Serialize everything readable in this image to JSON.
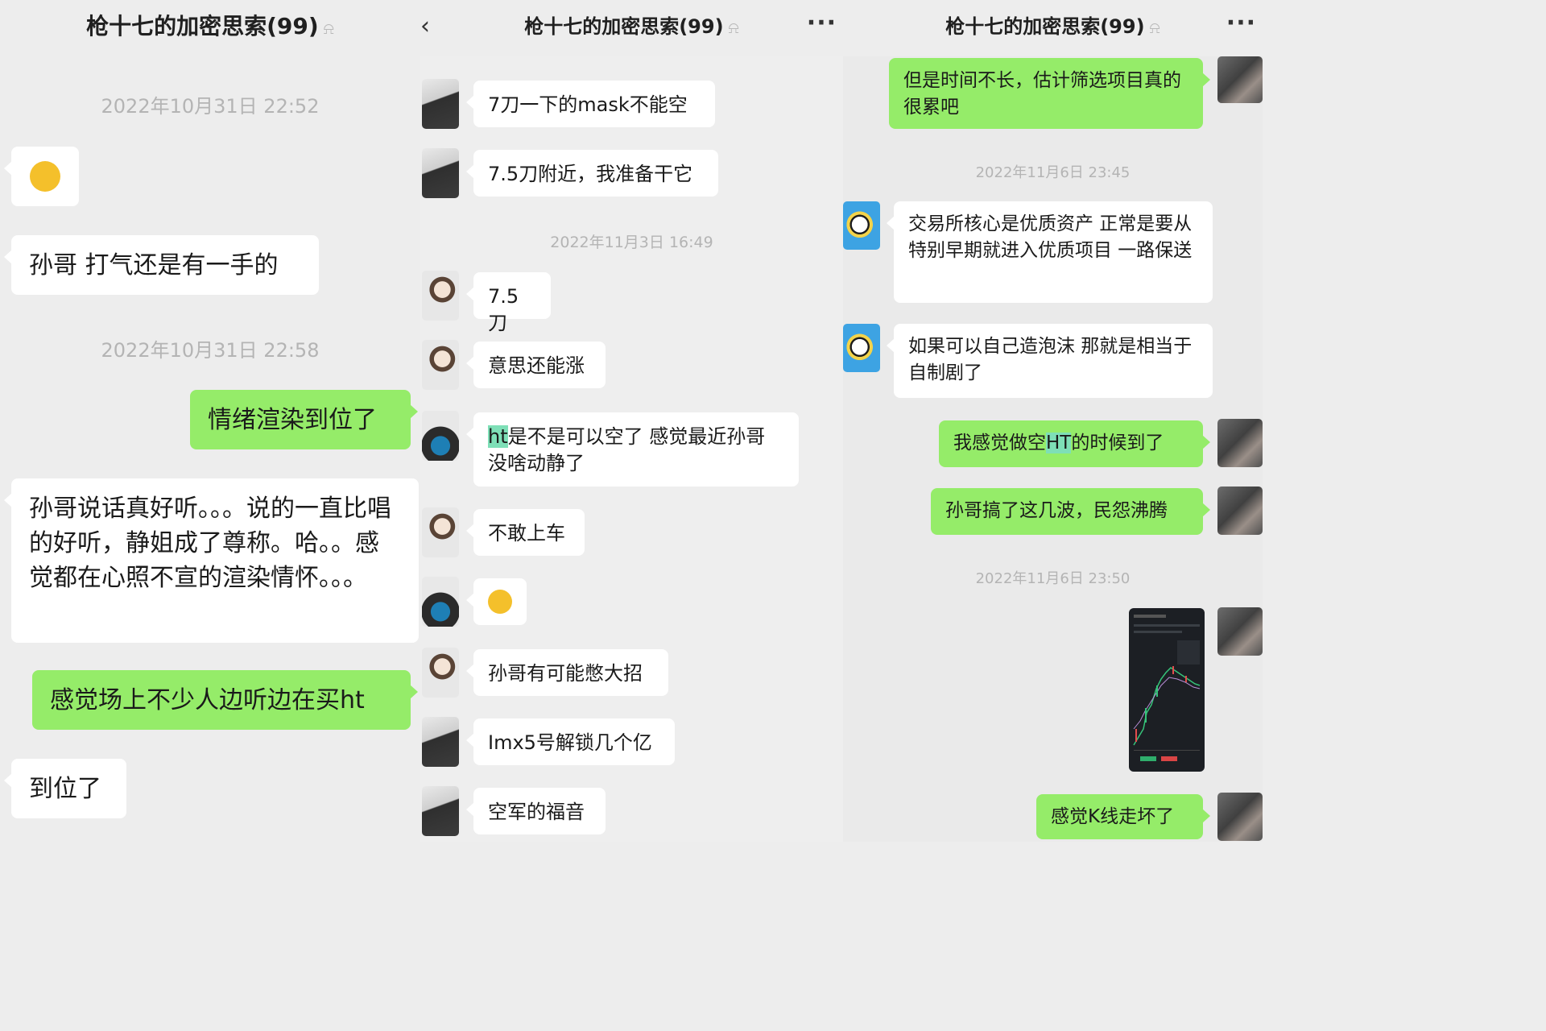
{
  "title": "枪十七的加密思索(99)",
  "p1": {
    "time1": "2022年10月31日 22:52",
    "m2": "孙哥 打气还是有一手的",
    "time2": "2022年10月31日 22:58",
    "m3": "情绪渲染到位了",
    "m4": "孙哥说话真好听。。。说的一直比唱的好听，静姐成了尊称。哈。。感觉都在心照不宣的渲染情怀。。。",
    "m5": "感觉场上不少人边听边在买ht",
    "m6": "到位了"
  },
  "p2": {
    "m1": "7刀一下的mask不能空",
    "m2": "7.5刀附近，我准备干它",
    "time1": "2022年11月3日 16:49",
    "m3": "7.5刀",
    "m4": "意思还能涨",
    "m5_hl": "ht",
    "m5_rest": "是不是可以空了 感觉最近孙哥没啥动静了",
    "m6": "不敢上车",
    "m8": "孙哥有可能憋大招",
    "m9": "Imx5号解锁几个亿",
    "m10": "空军的福音"
  },
  "p3": {
    "m1": "但是时间不长，估计筛选项目真的很累吧",
    "time1": "2022年11月6日 23:45",
    "m2": "交易所核心是优质资产 正常是要从特别早期就进入优质项目 一路保送",
    "m3": "如果可以自己造泡沫 那就是相当于 自制剧了",
    "m4_pre": "我感觉做空",
    "m4_hl": "HT",
    "m4_post": "的时候到了",
    "m5": "孙哥搞了这几波，民怨沸腾",
    "time2": "2022年11月6日 23:50",
    "m7": "感觉K线走坏了"
  },
  "icons": {
    "back": "‹",
    "more": "···",
    "mute": "🔕"
  }
}
